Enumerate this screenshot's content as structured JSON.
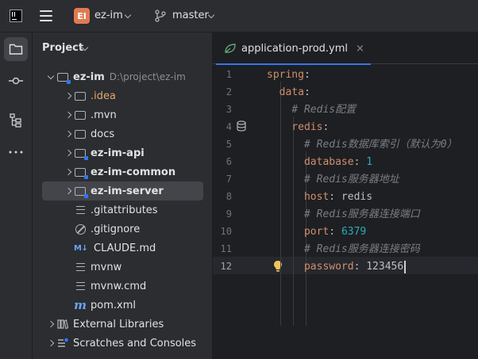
{
  "titlebar": {
    "project_badge": "EI",
    "project_name": "ez-im",
    "branch": "master"
  },
  "panel": {
    "title": "Project",
    "tree": [
      {
        "label": "ez-im",
        "path": "D:\\project\\ez-im",
        "style": "bold",
        "icon": "folder-module-icon",
        "arrow": "down"
      },
      {
        "label": ".idea",
        "style": "orange",
        "icon": "folder-icon",
        "arrow": "right"
      },
      {
        "label": ".mvn",
        "style": "normal",
        "icon": "folder-icon",
        "arrow": "right"
      },
      {
        "label": "docs",
        "style": "normal",
        "icon": "folder-icon",
        "arrow": "right"
      },
      {
        "label": "ez-im-api",
        "style": "bold",
        "icon": "folder-module-icon",
        "arrow": "right"
      },
      {
        "label": "ez-im-common",
        "style": "bold",
        "icon": "folder-module-icon",
        "arrow": "right"
      },
      {
        "label": "ez-im-server",
        "style": "bold",
        "icon": "folder-module-icon",
        "arrow": "right",
        "selected": true
      },
      {
        "label": ".gitattributes",
        "style": "normal",
        "icon": "text-file-icon"
      },
      {
        "label": ".gitignore",
        "style": "normal",
        "icon": "ignore-file-icon"
      },
      {
        "label": "CLAUDE.md",
        "style": "normal",
        "icon": "markdown-file-icon"
      },
      {
        "label": "mvnw",
        "style": "normal",
        "icon": "text-file-icon"
      },
      {
        "label": "mvnw.cmd",
        "style": "normal",
        "icon": "text-file-icon"
      },
      {
        "label": "pom.xml",
        "style": "normal",
        "icon": "maven-file-icon"
      },
      {
        "label": "External Libraries",
        "style": "normal",
        "icon": "libraries-icon",
        "arrow": "right"
      },
      {
        "label": "Scratches and Consoles",
        "style": "normal",
        "icon": "scratches-icon",
        "arrow": "right"
      }
    ],
    "md_icon_text": "M↓",
    "maven_icon_text": "m"
  },
  "editor": {
    "tab_label": "application-prod.yml",
    "tab_close": "×",
    "line_numbers": [
      "1",
      "2",
      "3",
      "4",
      "5",
      "6",
      "7",
      "8",
      "9",
      "10",
      "11",
      "12"
    ],
    "current_line": "12",
    "lines": [
      [
        {
          "t": "spring",
          "c": "key"
        },
        {
          "t": ":",
          "c": "txt"
        }
      ],
      [
        {
          "t": "  data",
          "c": "key"
        },
        {
          "t": ":",
          "c": "txt"
        }
      ],
      [
        {
          "t": "    # Redis配置",
          "c": "cmt"
        }
      ],
      [
        {
          "t": "    redis",
          "c": "key"
        },
        {
          "t": ":",
          "c": "txt"
        }
      ],
      [
        {
          "t": "      # Redis数据库索引（默认为0）",
          "c": "cmt"
        }
      ],
      [
        {
          "t": "      database",
          "c": "key"
        },
        {
          "t": ": ",
          "c": "txt"
        },
        {
          "t": "1",
          "c": "num"
        }
      ],
      [
        {
          "t": "      # Redis服务器地址",
          "c": "cmt"
        }
      ],
      [
        {
          "t": "      host",
          "c": "key"
        },
        {
          "t": ": redis",
          "c": "txt"
        }
      ],
      [
        {
          "t": "      # Redis服务器连接端口",
          "c": "cmt"
        }
      ],
      [
        {
          "t": "      port",
          "c": "key"
        },
        {
          "t": ": ",
          "c": "txt"
        },
        {
          "t": "6379",
          "c": "num"
        }
      ],
      [
        {
          "t": "      # Redis服务器连接密码",
          "c": "cmt"
        }
      ],
      [
        {
          "t": "      password",
          "c": "key"
        },
        {
          "t": ": 123456",
          "c": "txt"
        }
      ]
    ]
  }
}
